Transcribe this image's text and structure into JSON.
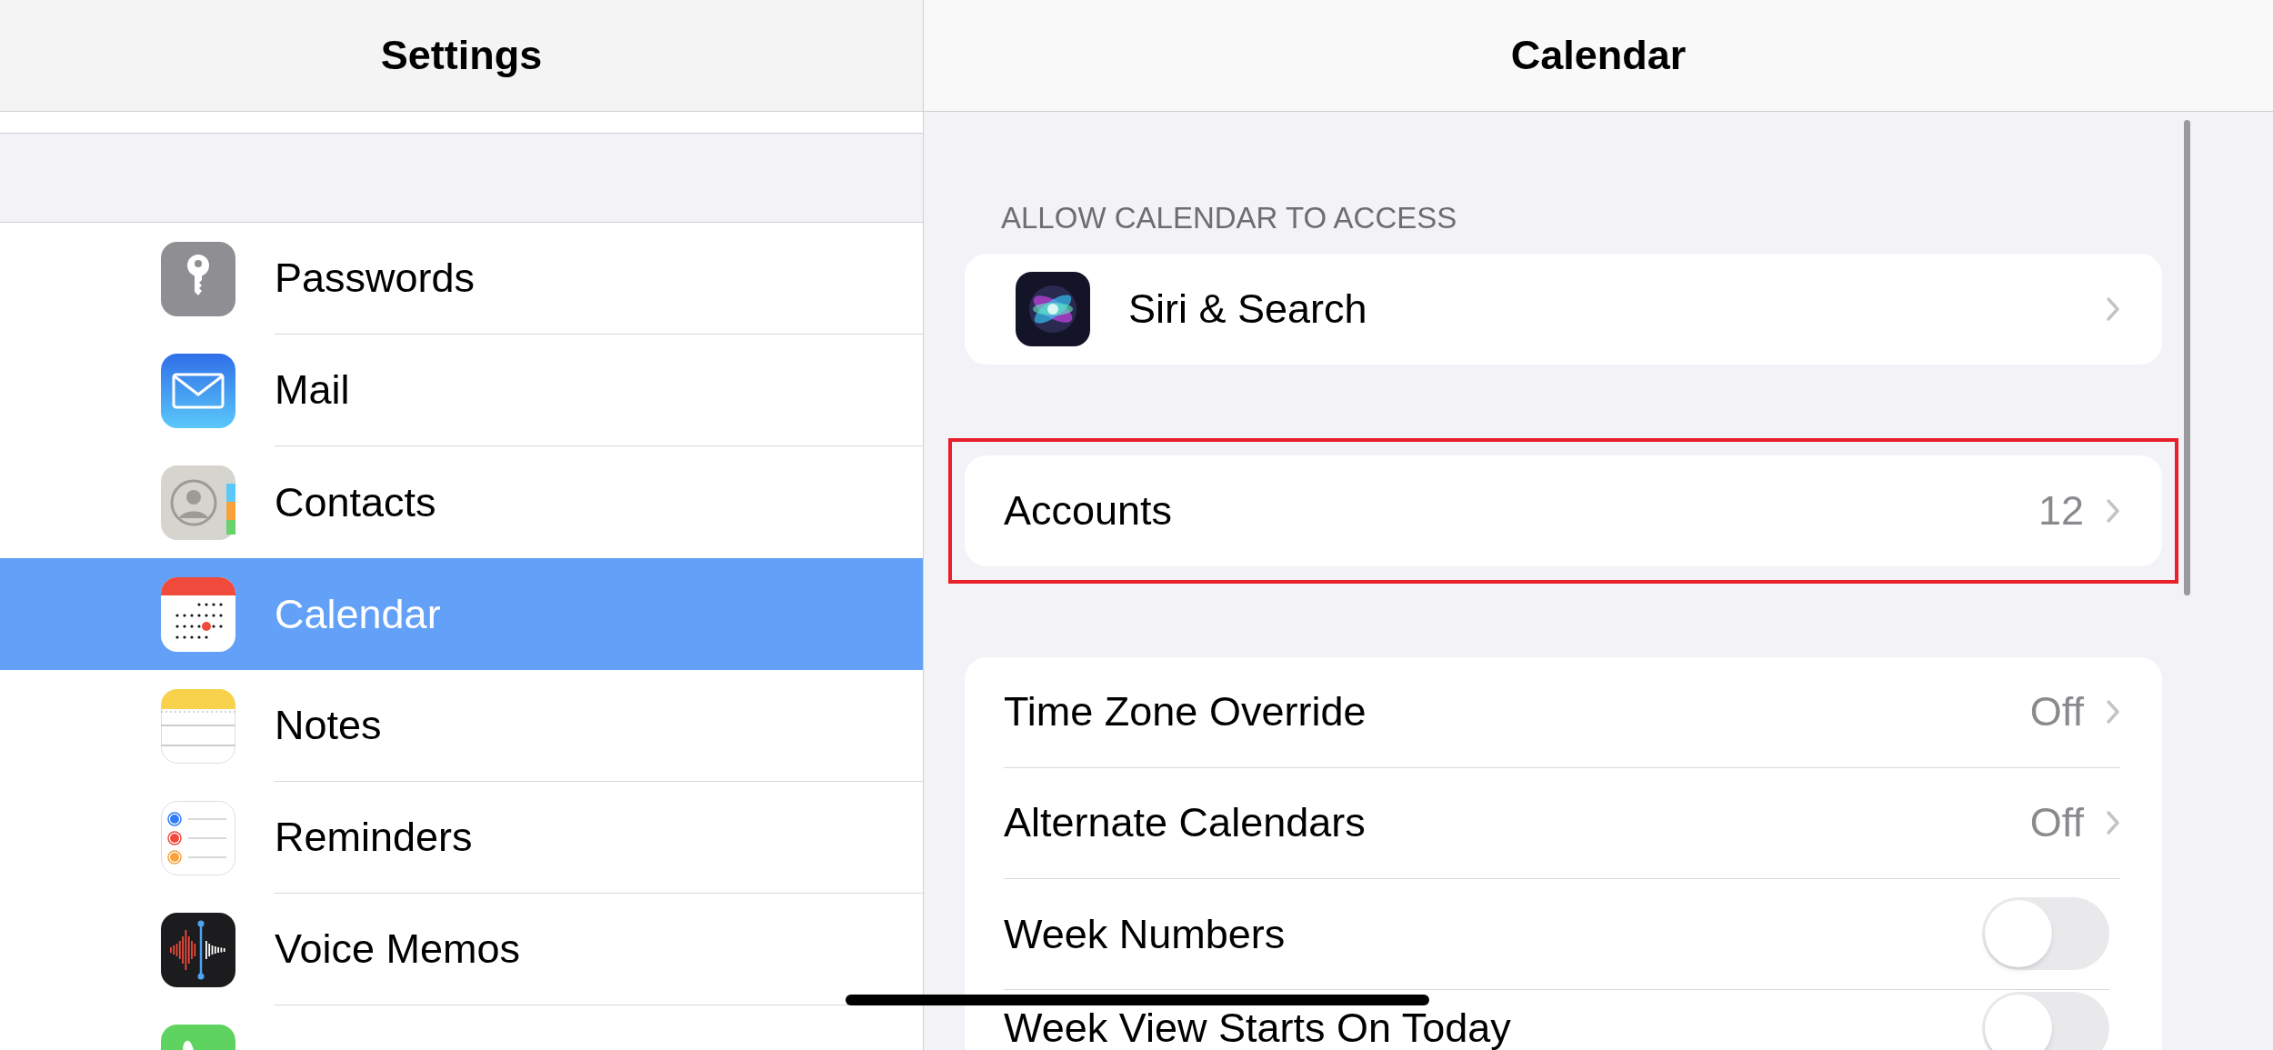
{
  "sidebar": {
    "title": "Settings",
    "items": [
      {
        "label": "Passwords",
        "selected": false
      },
      {
        "label": "Mail",
        "selected": false
      },
      {
        "label": "Contacts",
        "selected": false
      },
      {
        "label": "Calendar",
        "selected": true
      },
      {
        "label": "Notes",
        "selected": false
      },
      {
        "label": "Reminders",
        "selected": false
      },
      {
        "label": "Voice Memos",
        "selected": false
      },
      {
        "selected": false
      }
    ]
  },
  "detail": {
    "title": "Calendar",
    "section_header": "ALLOW CALENDAR TO ACCESS",
    "groups": [
      {
        "highlighted": false,
        "rows": [
          {
            "kind": "app_link",
            "label": "Siri & Search"
          }
        ]
      },
      {
        "highlighted": true,
        "rows": [
          {
            "kind": "link",
            "label": "Accounts",
            "value": "12"
          }
        ]
      },
      {
        "highlighted": false,
        "rows": [
          {
            "kind": "link",
            "label": "Time Zone Override",
            "value": "Off"
          },
          {
            "kind": "link",
            "label": "Alternate Calendars",
            "value": "Off"
          },
          {
            "kind": "toggle",
            "label": "Week Numbers",
            "on": false
          },
          {
            "kind": "toggle",
            "label": "Week View Starts On Today",
            "on": false
          }
        ]
      }
    ]
  }
}
